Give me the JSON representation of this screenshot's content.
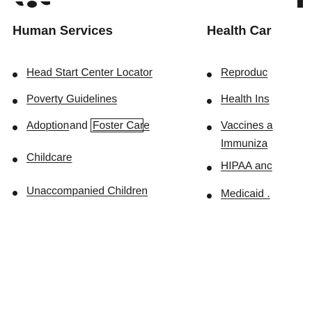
{
  "left_section": {
    "heading": "Human Services",
    "links": [
      {
        "label": "Head Start Center Locator"
      },
      {
        "label": "Poverty Guidelines"
      },
      {
        "label_part1": "Adoption",
        "label_part2": "and",
        "label_part3": "Foster Care"
      },
      {
        "label": "Childcare"
      },
      {
        "label": "Unaccompanied Children"
      }
    ]
  },
  "right_section": {
    "heading": "Health Car",
    "links": [
      {
        "label": "Reproduc"
      },
      {
        "label": "Health Ins"
      },
      {
        "label_line1": "Vaccines a",
        "label_line2": "Immuniza"
      },
      {
        "label": "HIPAA anc"
      },
      {
        "label": "Medicaid ."
      }
    ]
  },
  "colors": {
    "text": "#1b1b1b",
    "logo": "#1b1b1b",
    "background": "#ffffff"
  }
}
